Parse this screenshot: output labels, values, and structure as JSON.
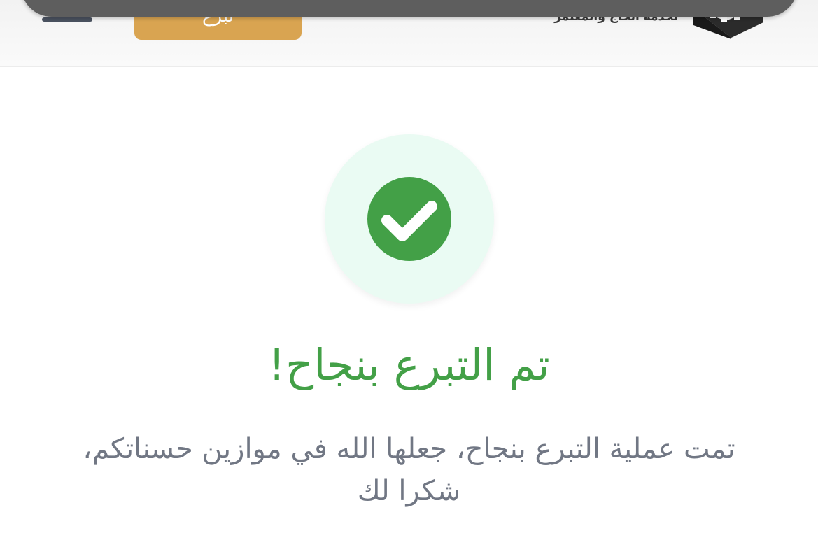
{
  "header": {
    "donate_button_label": "تبرع",
    "brand_tagline": "لخدمة الحاج والمعتمر",
    "menu_icon": "hamburger-menu-icon",
    "logo_icon": "brand-logo-icon"
  },
  "success": {
    "icon": "check-circle-icon",
    "title": "تم التبرع بنجاح!",
    "message_line1": "تمت عملية التبرع بنجاح، جعلها الله في موازين حسناتكم،",
    "message_line2": "شكرا لك"
  },
  "colors": {
    "accent_green": "#43a047",
    "badge_background": "#eafbf3",
    "donate_button": "#d9a451",
    "body_text": "#717784"
  }
}
